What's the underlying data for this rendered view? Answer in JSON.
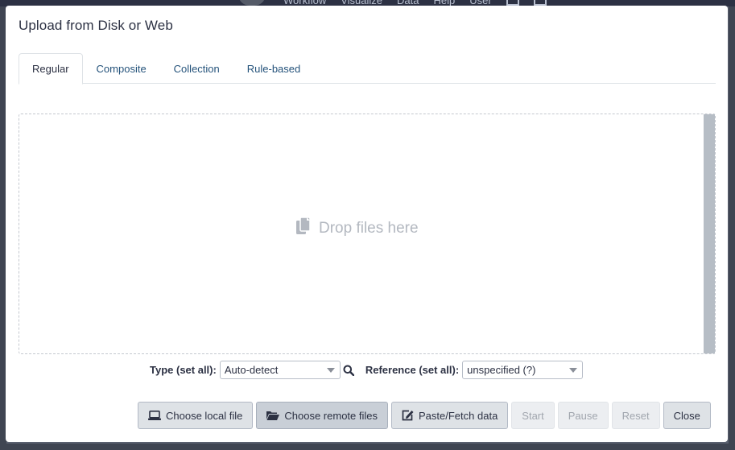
{
  "masthead": {
    "items": [
      "Workflow",
      "Visualize",
      "Data",
      "Help",
      "User"
    ]
  },
  "modal": {
    "title": "Upload from Disk or Web"
  },
  "tabs": [
    {
      "label": "Regular",
      "active": true
    },
    {
      "label": "Composite",
      "active": false
    },
    {
      "label": "Collection",
      "active": false
    },
    {
      "label": "Rule-based",
      "active": false
    }
  ],
  "dropzone": {
    "hint": "Drop files here",
    "icon": "copy-icon"
  },
  "settings": {
    "type_label": "Type (set all):",
    "type_value": "Auto-detect",
    "reference_label": "Reference (set all):",
    "reference_value": "unspecified (?)"
  },
  "footer": {
    "choose_local": "Choose local file",
    "choose_remote": "Choose remote files",
    "paste_fetch": "Paste/Fetch data",
    "start": "Start",
    "pause": "Pause",
    "reset": "Reset",
    "close": "Close"
  },
  "colors": {
    "link": "#25537b",
    "button_bg": "#dee2e6",
    "disabled_text": "#a1a6ae"
  }
}
